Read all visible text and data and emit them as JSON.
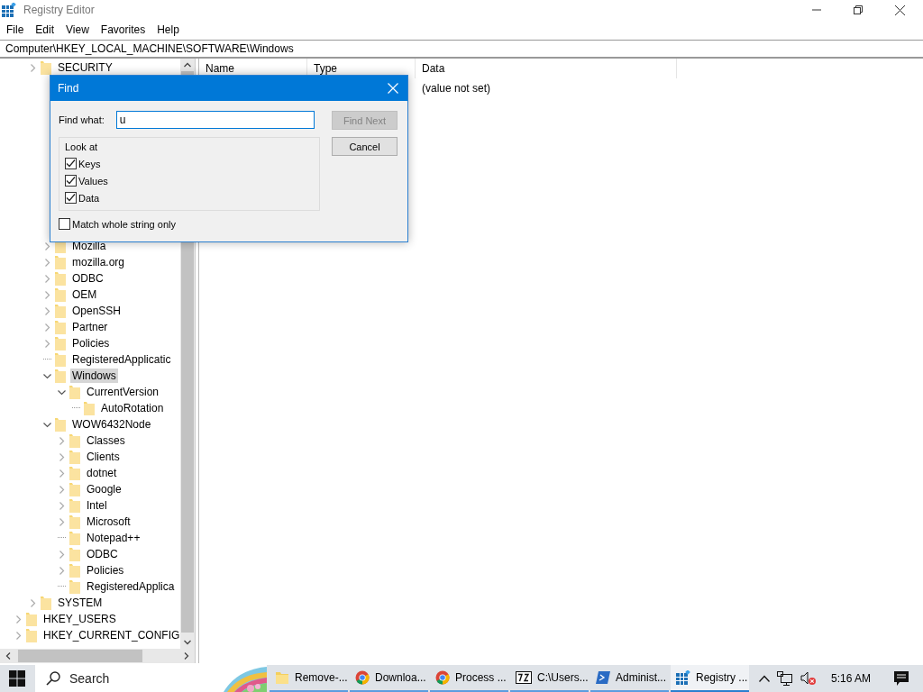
{
  "window": {
    "title": "Registry Editor"
  },
  "menu": [
    "File",
    "Edit",
    "View",
    "Favorites",
    "Help"
  ],
  "address": "Computer\\HKEY_LOCAL_MACHINE\\SOFTWARE\\Windows",
  "tree": [
    {
      "children": [
        {
          "label": "SECURITY",
          "expanded": false,
          "selected": false
        },
        {
          "children": [
            {
              "label": "Mozilla",
              "expanded": false,
              "selected": false
            },
            {
              "label": "mozilla.org",
              "expanded": false,
              "selected": false
            },
            {
              "label": "ODBC",
              "expanded": false,
              "selected": false
            },
            {
              "label": "OEM",
              "expanded": false,
              "selected": false
            },
            {
              "label": "OpenSSH",
              "expanded": false,
              "selected": false
            },
            {
              "label": "Partner",
              "expanded": false,
              "selected": false
            },
            {
              "label": "Policies",
              "expanded": false,
              "selected": false
            },
            {
              "label": "RegisteredApplicatic",
              "selected": false
            },
            {
              "label": "Windows",
              "expanded": true,
              "selected": true,
              "children": [
                {
                  "label": "CurrentVersion",
                  "expanded": true,
                  "selected": false,
                  "children": [
                    {
                      "label": "AutoRotation",
                      "selected": false
                    }
                  ]
                }
              ]
            },
            {
              "label": "WOW6432Node",
              "expanded": true,
              "selected": false,
              "children": [
                {
                  "label": "Classes",
                  "expanded": false,
                  "selected": false
                },
                {
                  "label": "Clients",
                  "expanded": false,
                  "selected": false
                },
                {
                  "label": "dotnet",
                  "expanded": false,
                  "selected": false
                },
                {
                  "label": "Google",
                  "expanded": false,
                  "selected": false
                },
                {
                  "label": "Intel",
                  "expanded": false,
                  "selected": false
                },
                {
                  "label": "Microsoft",
                  "expanded": false,
                  "selected": false
                },
                {
                  "label": "Notepad++",
                  "selected": false
                },
                {
                  "label": "ODBC",
                  "expanded": false,
                  "selected": false
                },
                {
                  "label": "Policies",
                  "expanded": false,
                  "selected": false
                },
                {
                  "label": "RegisteredApplica",
                  "selected": false
                }
              ]
            }
          ]
        },
        {
          "label": "SYSTEM",
          "expanded": false,
          "selected": false
        }
      ]
    },
    {
      "label": "HKEY_USERS",
      "expanded": false,
      "selected": false
    },
    {
      "label": "HKEY_CURRENT_CONFIG",
      "expanded": false,
      "selected": false
    }
  ],
  "list": {
    "columns": [
      "Name",
      "Type",
      "Data"
    ],
    "rows": [
      {
        "data": "(value not set)"
      }
    ]
  },
  "find_dialog": {
    "title": "Find",
    "find_what_label": "Find what:",
    "find_what_value": "u",
    "look_at_label": "Look at",
    "options": [
      {
        "label": "Keys",
        "checked": true
      },
      {
        "label": "Values",
        "checked": true
      },
      {
        "label": "Data",
        "checked": true
      }
    ],
    "match_whole": {
      "label": "Match whole string only",
      "checked": false
    },
    "buttons": [
      {
        "label": "Find Next",
        "disabled": true
      },
      {
        "label": "Cancel",
        "disabled": false
      }
    ]
  },
  "taskbar": {
    "search": "Search",
    "apps": [
      {
        "kind": "folder",
        "label": "Remove-...",
        "selected": false
      },
      {
        "kind": "browser",
        "label": "Downloa...",
        "selected": false
      },
      {
        "kind": "browser",
        "label": "Process ...",
        "selected": false
      },
      {
        "kind": "archiver",
        "label": "C:\\Users...",
        "selected": false
      },
      {
        "kind": "shell",
        "label": "Administ...",
        "selected": false
      },
      {
        "kind": "registry",
        "label": "Registry ...",
        "selected": true
      }
    ],
    "time": "5:16 AM"
  }
}
